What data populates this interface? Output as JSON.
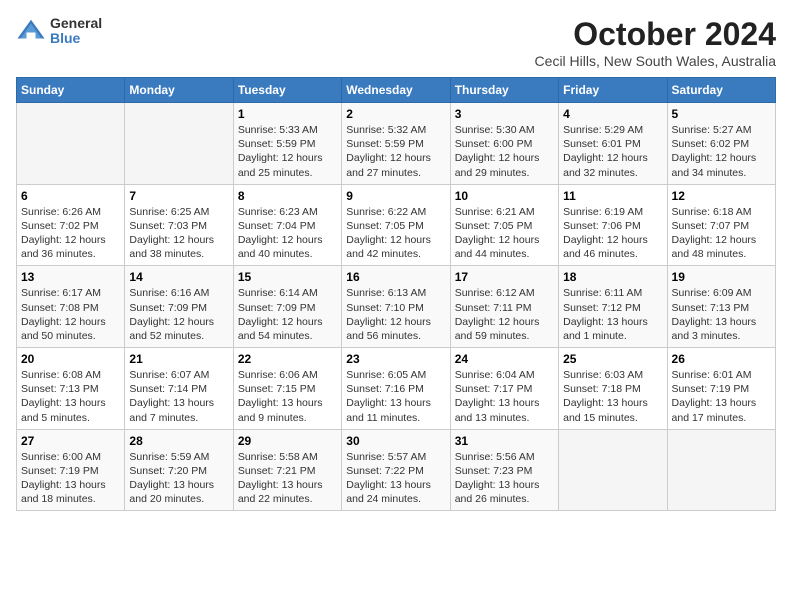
{
  "header": {
    "logo_general": "General",
    "logo_blue": "Blue",
    "title": "October 2024",
    "subtitle": "Cecil Hills, New South Wales, Australia"
  },
  "days_of_week": [
    "Sunday",
    "Monday",
    "Tuesday",
    "Wednesday",
    "Thursday",
    "Friday",
    "Saturday"
  ],
  "weeks": [
    [
      {
        "day": "",
        "info": ""
      },
      {
        "day": "",
        "info": ""
      },
      {
        "day": "1",
        "info": "Sunrise: 5:33 AM\nSunset: 5:59 PM\nDaylight: 12 hours and 25 minutes."
      },
      {
        "day": "2",
        "info": "Sunrise: 5:32 AM\nSunset: 5:59 PM\nDaylight: 12 hours and 27 minutes."
      },
      {
        "day": "3",
        "info": "Sunrise: 5:30 AM\nSunset: 6:00 PM\nDaylight: 12 hours and 29 minutes."
      },
      {
        "day": "4",
        "info": "Sunrise: 5:29 AM\nSunset: 6:01 PM\nDaylight: 12 hours and 32 minutes."
      },
      {
        "day": "5",
        "info": "Sunrise: 5:27 AM\nSunset: 6:02 PM\nDaylight: 12 hours and 34 minutes."
      }
    ],
    [
      {
        "day": "6",
        "info": "Sunrise: 6:26 AM\nSunset: 7:02 PM\nDaylight: 12 hours and 36 minutes."
      },
      {
        "day": "7",
        "info": "Sunrise: 6:25 AM\nSunset: 7:03 PM\nDaylight: 12 hours and 38 minutes."
      },
      {
        "day": "8",
        "info": "Sunrise: 6:23 AM\nSunset: 7:04 PM\nDaylight: 12 hours and 40 minutes."
      },
      {
        "day": "9",
        "info": "Sunrise: 6:22 AM\nSunset: 7:05 PM\nDaylight: 12 hours and 42 minutes."
      },
      {
        "day": "10",
        "info": "Sunrise: 6:21 AM\nSunset: 7:05 PM\nDaylight: 12 hours and 44 minutes."
      },
      {
        "day": "11",
        "info": "Sunrise: 6:19 AM\nSunset: 7:06 PM\nDaylight: 12 hours and 46 minutes."
      },
      {
        "day": "12",
        "info": "Sunrise: 6:18 AM\nSunset: 7:07 PM\nDaylight: 12 hours and 48 minutes."
      }
    ],
    [
      {
        "day": "13",
        "info": "Sunrise: 6:17 AM\nSunset: 7:08 PM\nDaylight: 12 hours and 50 minutes."
      },
      {
        "day": "14",
        "info": "Sunrise: 6:16 AM\nSunset: 7:09 PM\nDaylight: 12 hours and 52 minutes."
      },
      {
        "day": "15",
        "info": "Sunrise: 6:14 AM\nSunset: 7:09 PM\nDaylight: 12 hours and 54 minutes."
      },
      {
        "day": "16",
        "info": "Sunrise: 6:13 AM\nSunset: 7:10 PM\nDaylight: 12 hours and 56 minutes."
      },
      {
        "day": "17",
        "info": "Sunrise: 6:12 AM\nSunset: 7:11 PM\nDaylight: 12 hours and 59 minutes."
      },
      {
        "day": "18",
        "info": "Sunrise: 6:11 AM\nSunset: 7:12 PM\nDaylight: 13 hours and 1 minute."
      },
      {
        "day": "19",
        "info": "Sunrise: 6:09 AM\nSunset: 7:13 PM\nDaylight: 13 hours and 3 minutes."
      }
    ],
    [
      {
        "day": "20",
        "info": "Sunrise: 6:08 AM\nSunset: 7:13 PM\nDaylight: 13 hours and 5 minutes."
      },
      {
        "day": "21",
        "info": "Sunrise: 6:07 AM\nSunset: 7:14 PM\nDaylight: 13 hours and 7 minutes."
      },
      {
        "day": "22",
        "info": "Sunrise: 6:06 AM\nSunset: 7:15 PM\nDaylight: 13 hours and 9 minutes."
      },
      {
        "day": "23",
        "info": "Sunrise: 6:05 AM\nSunset: 7:16 PM\nDaylight: 13 hours and 11 minutes."
      },
      {
        "day": "24",
        "info": "Sunrise: 6:04 AM\nSunset: 7:17 PM\nDaylight: 13 hours and 13 minutes."
      },
      {
        "day": "25",
        "info": "Sunrise: 6:03 AM\nSunset: 7:18 PM\nDaylight: 13 hours and 15 minutes."
      },
      {
        "day": "26",
        "info": "Sunrise: 6:01 AM\nSunset: 7:19 PM\nDaylight: 13 hours and 17 minutes."
      }
    ],
    [
      {
        "day": "27",
        "info": "Sunrise: 6:00 AM\nSunset: 7:19 PM\nDaylight: 13 hours and 18 minutes."
      },
      {
        "day": "28",
        "info": "Sunrise: 5:59 AM\nSunset: 7:20 PM\nDaylight: 13 hours and 20 minutes."
      },
      {
        "day": "29",
        "info": "Sunrise: 5:58 AM\nSunset: 7:21 PM\nDaylight: 13 hours and 22 minutes."
      },
      {
        "day": "30",
        "info": "Sunrise: 5:57 AM\nSunset: 7:22 PM\nDaylight: 13 hours and 24 minutes."
      },
      {
        "day": "31",
        "info": "Sunrise: 5:56 AM\nSunset: 7:23 PM\nDaylight: 13 hours and 26 minutes."
      },
      {
        "day": "",
        "info": ""
      },
      {
        "day": "",
        "info": ""
      }
    ]
  ]
}
